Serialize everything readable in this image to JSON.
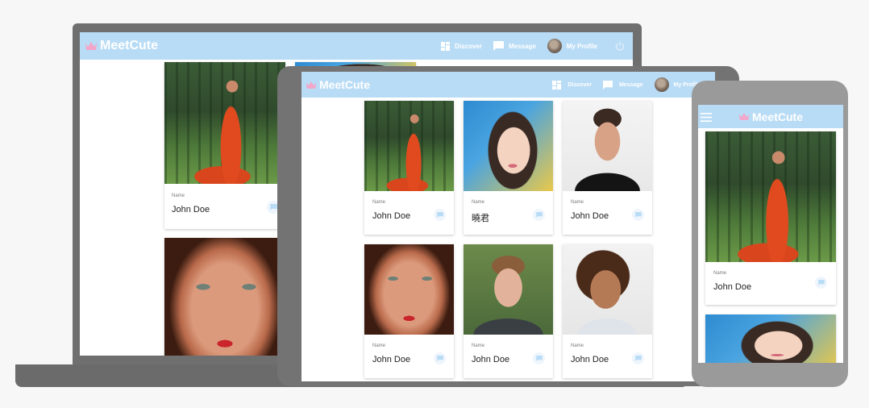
{
  "app": {
    "name": "MeetCute",
    "nav": {
      "discover": "Discover",
      "message": "Message",
      "profile": "My Profile"
    },
    "colors": {
      "appbar": "#b9dcf6",
      "logo_icon": "#f3a6c8",
      "chat_icon": "#b9dcf6"
    }
  },
  "laptop": {
    "cards": [
      {
        "label": "Name",
        "name": "John Doe",
        "photo": "woman-red-dress-forest"
      },
      {
        "label": "",
        "name": "",
        "photo": "woman-red-hair-closeup"
      }
    ]
  },
  "tablet": {
    "cards": [
      {
        "label": "Name",
        "name": "John Doe",
        "photo": "woman-red-dress-forest"
      },
      {
        "label": "Name",
        "name": "曉君",
        "photo": "asian-woman-portrait"
      },
      {
        "label": "Name",
        "name": "John Doe",
        "photo": "man-black-sweater"
      },
      {
        "label": "Name",
        "name": "John Doe",
        "photo": "woman-red-hair-closeup"
      },
      {
        "label": "Name",
        "name": "John Doe",
        "photo": "young-man-plaid-shirt"
      },
      {
        "label": "Name",
        "name": "John Doe",
        "photo": "woman-curly-hair"
      }
    ]
  },
  "phone": {
    "cards": [
      {
        "label": "Name",
        "name": "John Doe",
        "photo": "woman-red-dress-forest"
      },
      {
        "label": "",
        "name": "",
        "photo": "asian-woman-portrait"
      }
    ]
  }
}
